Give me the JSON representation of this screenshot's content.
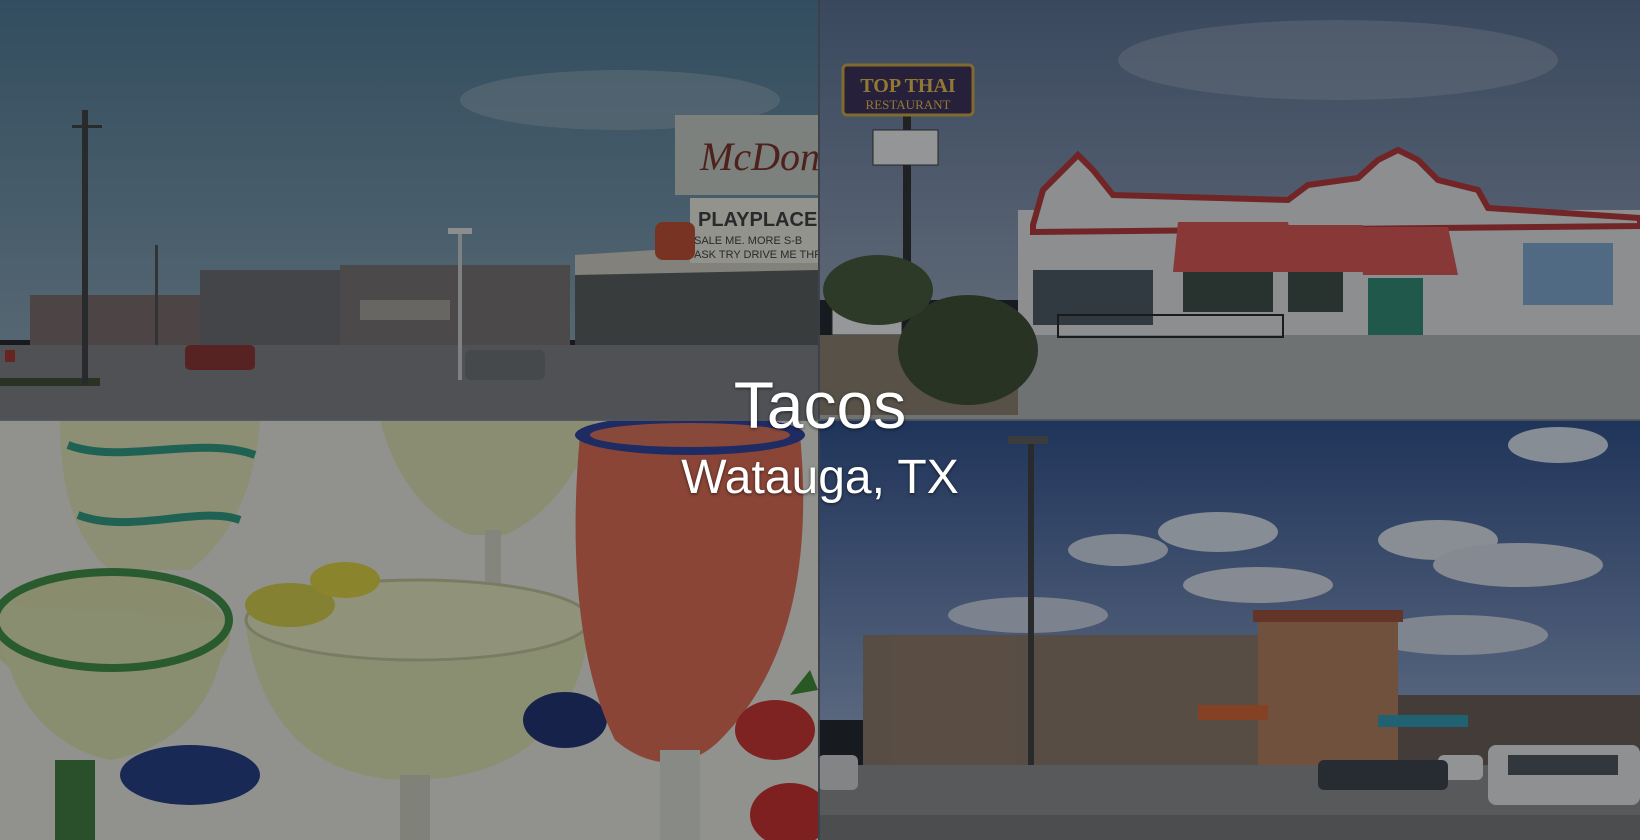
{
  "overlay": {
    "title": "Tacos",
    "subtitle": "Watauga, TX"
  },
  "photos": [
    {
      "name": "mcdonalds-strip-photo",
      "signs": [
        "McDona",
        "PLAYPLACE",
        "SALE ME. MORE S-B",
        "ASK TRY DRIVE ME THRU"
      ]
    },
    {
      "name": "top-thai-restaurant-photo",
      "signs": [
        "TOP THAI",
        "RESTAURANT"
      ]
    },
    {
      "name": "margaritas-photo",
      "signs": []
    },
    {
      "name": "restaurant-parking-lot-photo",
      "signs": []
    }
  ],
  "colors": {
    "text": "#ffffff",
    "shade": "rgba(15,18,24,0.42)"
  }
}
